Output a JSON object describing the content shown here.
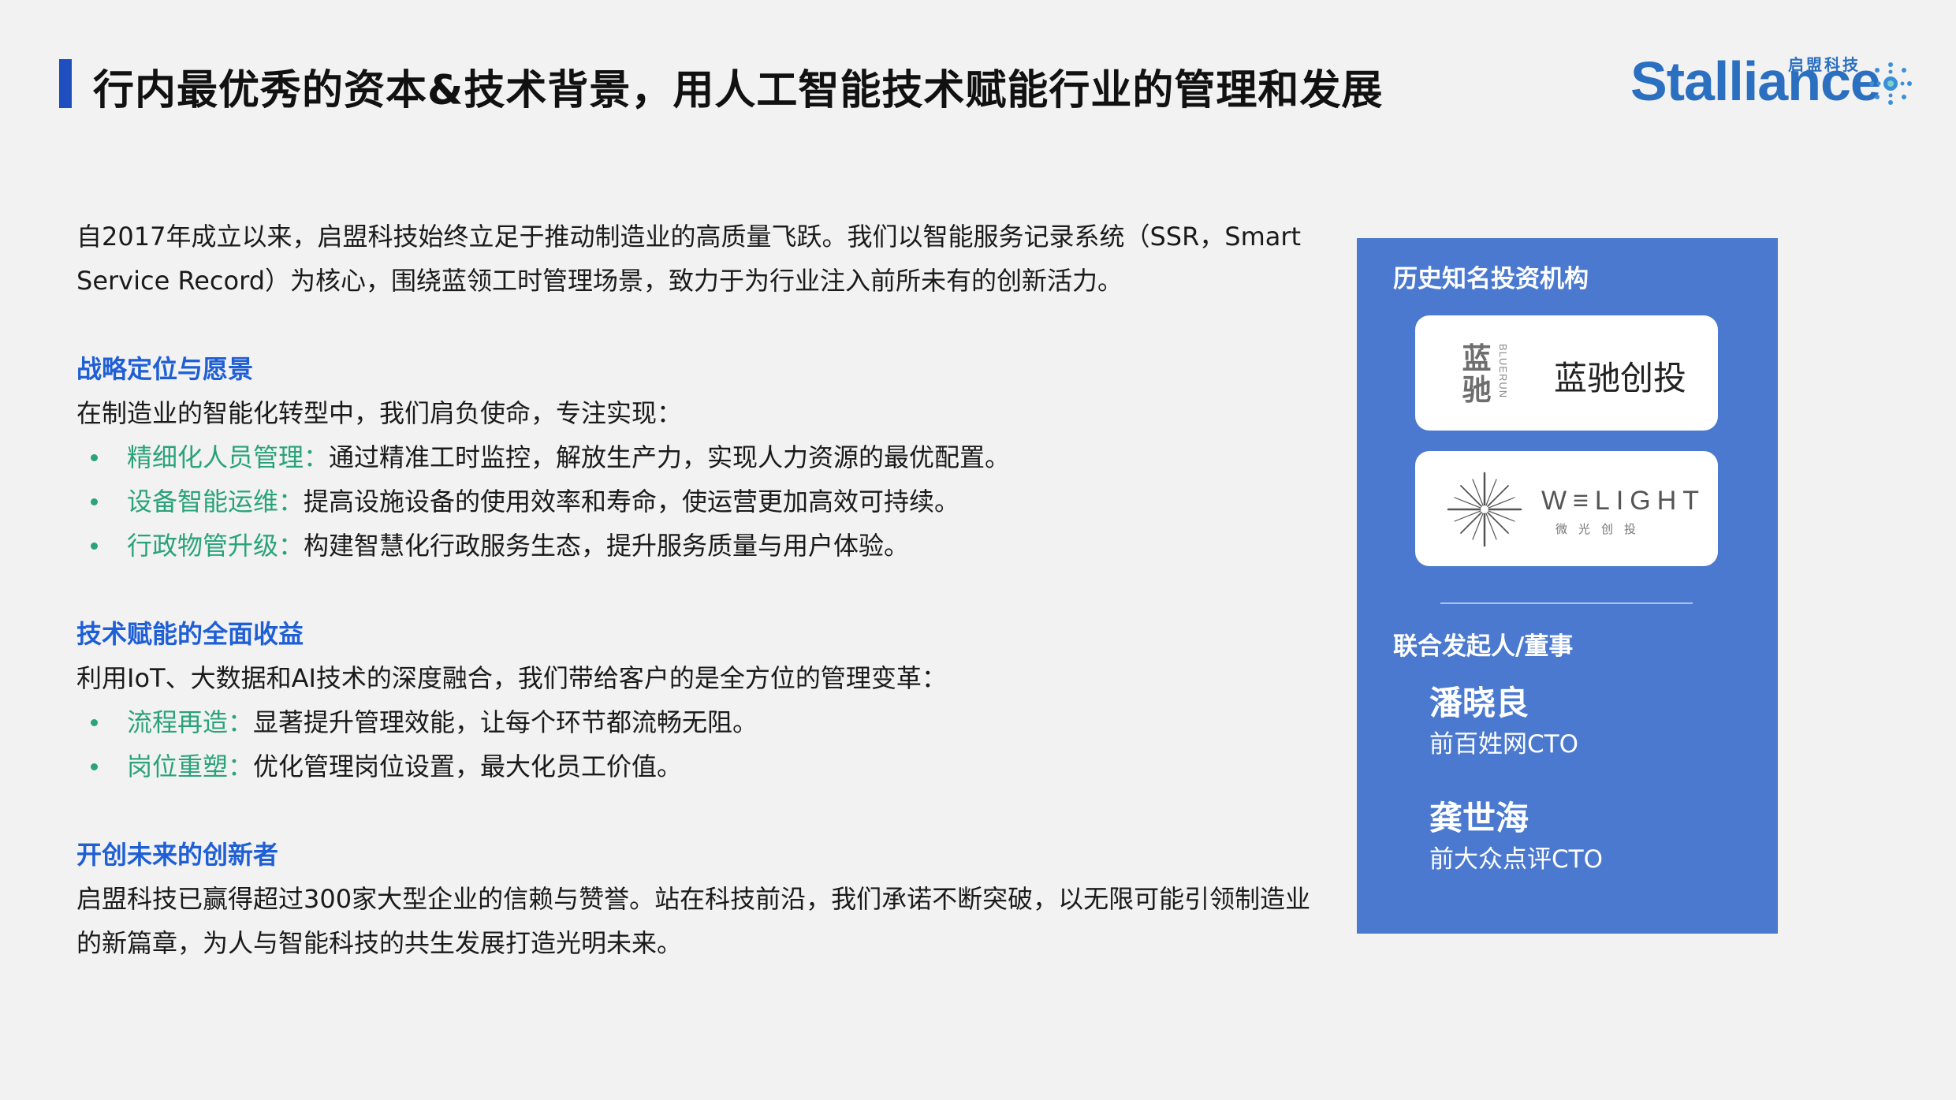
{
  "header": {
    "title": "行内最优秀的资本&技术背景，用人工智能技术赋能行业的管理和发展",
    "logo_word": "Stalliance",
    "logo_cn": "启盟科技"
  },
  "intro": "自2017年成立以来，启盟科技始终立足于推动制造业的高质量飞跃。我们以智能服务记录系统（SSR，Smart Service Record）为核心，围绕蓝领工时管理场景，致力于为行业注入前所未有的创新活力。",
  "sections": [
    {
      "title": "战略定位与愿景",
      "lead": "在制造业的智能化转型中，我们肩负使命，专注实现：",
      "items": [
        {
          "key": "精细化人员管理：",
          "text": "通过精准工时监控，解放生产力，实现人力资源的最优配置。"
        },
        {
          "key": "设备智能运维：",
          "text": "提高设施设备的使用效率和寿命，使运营更加高效可持续。"
        },
        {
          "key": "行政物管升级：",
          "text": "构建智慧化行政服务生态，提升服务质量与用户体验。"
        }
      ]
    },
    {
      "title": "技术赋能的全面收益",
      "lead": "利用IoT、大数据和AI技术的深度融合，我们带给客户的是全方位的管理变革：",
      "items": [
        {
          "key": "流程再造：",
          "text": "显著提升管理效能，让每个环节都流畅无阻。"
        },
        {
          "key": "岗位重塑：",
          "text": "优化管理岗位设置，最大化员工价值。"
        }
      ]
    },
    {
      "title": "开创未来的创新者",
      "lead": "启盟科技已赢得超过300家大型企业的信赖与赞誉。站在科技前沿，我们承诺不断突破，以无限可能引领制造业的新篇章，为人与智能科技的共生发展打造光明未来。"
    }
  ],
  "panel": {
    "investors_title": "历史知名投资机构",
    "investor1": {
      "seal_top": "蓝",
      "seal_bottom": "驰",
      "seal_en": "BLUERUN",
      "name": "蓝驰创投"
    },
    "investor2": {
      "name": "W≡LIGHT",
      "name_cn": "微光创投"
    },
    "founders_title": "联合发起人/董事",
    "founders": [
      {
        "name": "潘晓良",
        "role": "前百姓网CTO"
      },
      {
        "name": "龚世海",
        "role": "前大众点评CTO"
      }
    ]
  },
  "colors": {
    "accent_blue": "#1f5fd6",
    "title_bar": "#1f4fbf",
    "bullet_green": "#2aa37a",
    "panel_bg": "#4a79cf",
    "logo_blue": "#2a6fc0"
  }
}
